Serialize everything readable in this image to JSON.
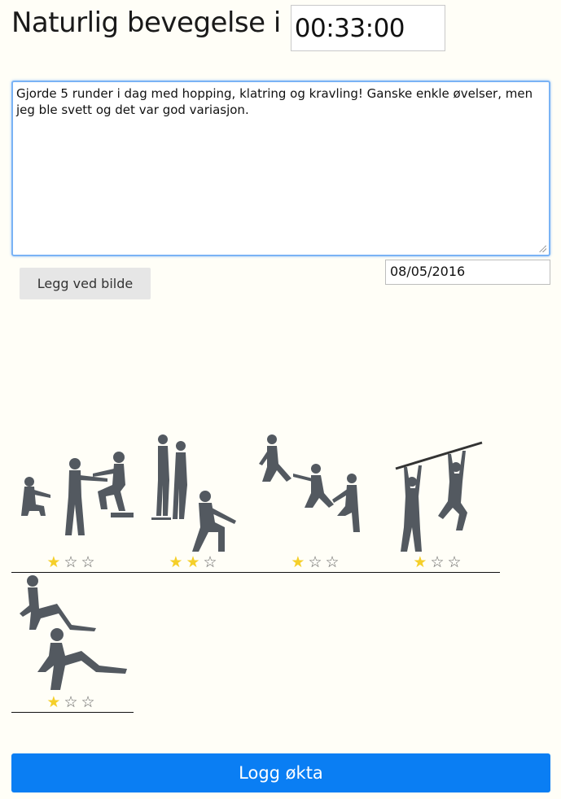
{
  "header": {
    "title": "Naturlig bevegelse i",
    "duration_value": "00:33:00"
  },
  "notes": {
    "value": "Gjorde 5 runder i dag med hopping, klatring og kravling! Ganske enkle øvelser, men jeg ble svett og det var god variasjon."
  },
  "attach_button_label": "Legg ved bilde",
  "date_value": "08/05/2016",
  "star_on_glyph": "★",
  "star_off_glyph": "☆",
  "exercises": [
    {
      "icon": "squat-step-figures-icon",
      "rating": 1,
      "max": 3
    },
    {
      "icon": "standing-squat-figures-icon",
      "rating": 2,
      "max": 3
    },
    {
      "icon": "lunge-jump-figures-icon",
      "rating": 1,
      "max": 3
    },
    {
      "icon": "pull-up-bar-figures-icon",
      "rating": 1,
      "max": 3
    },
    {
      "icon": "floor-crawl-figures-icon",
      "rating": 1,
      "max": 3
    }
  ],
  "submit_label": "Logg økta",
  "colors": {
    "accent": "#0a7ef3",
    "star_active": "#f5cf2a",
    "background": "#fffef7",
    "focus_border": "#7ab3f5"
  }
}
